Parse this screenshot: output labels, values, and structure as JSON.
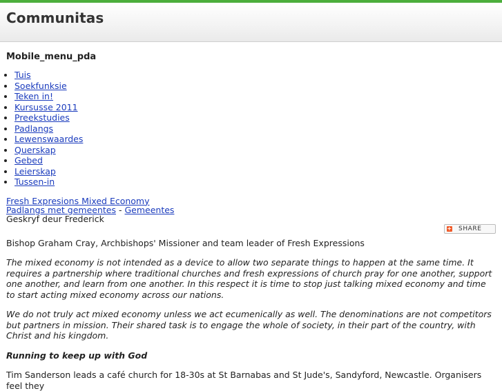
{
  "site": {
    "title": "Communitas"
  },
  "menu": {
    "heading": "Mobile_menu_pda",
    "items": [
      {
        "label": "Tuis"
      },
      {
        "label": "Soekfunksie"
      },
      {
        "label": "Teken in!"
      },
      {
        "label": "Kursusse 2011"
      },
      {
        "label": "Preekstudies"
      },
      {
        "label": "Padlangs"
      },
      {
        "label": "Lewenswaardes"
      },
      {
        "label": "Querskap"
      },
      {
        "label": "Gebed"
      },
      {
        "label": "Leierskap"
      },
      {
        "label": "Tussen-in"
      }
    ]
  },
  "article": {
    "title_link": "Fresh Expresions Mixed Economy",
    "crumb1": "Padlangs met gemeentes",
    "separator": "-",
    "crumb2": "Gemeentes",
    "author": "Geskryf deur Frederick",
    "share_label": "SHARE",
    "share_symbol": "+",
    "intro": "Bishop Graham Cray, Archbishops' Missioner and team leader of Fresh Expressions",
    "quote1": "The mixed economy is not intended as a device to allow two separate things to happen at the same time. It requires a partnership where traditional churches and fresh expressions of church pray for one another, support one another, and learn from one another. In this respect it is time to stop just talking mixed economy and time to start acting mixed economy across our nations.",
    "quote2": "We do not truly act mixed economy unless we act ecumenically as well. The denominations are not competitors but partners in mission. Their shared task is to engage the whole of society, in their part of the country, with Christ and his kingdom.",
    "subheading": "Running to keep up with God",
    "body": "Tim Sanderson leads a café church for 18-30s at St Barnabas and St Jude's, Sandyford, Newcastle. Organisers feel they"
  },
  "colors": {
    "topbar": "#4cae3c",
    "link": "#1a3bbd",
    "share_icon": "#f05a28"
  }
}
